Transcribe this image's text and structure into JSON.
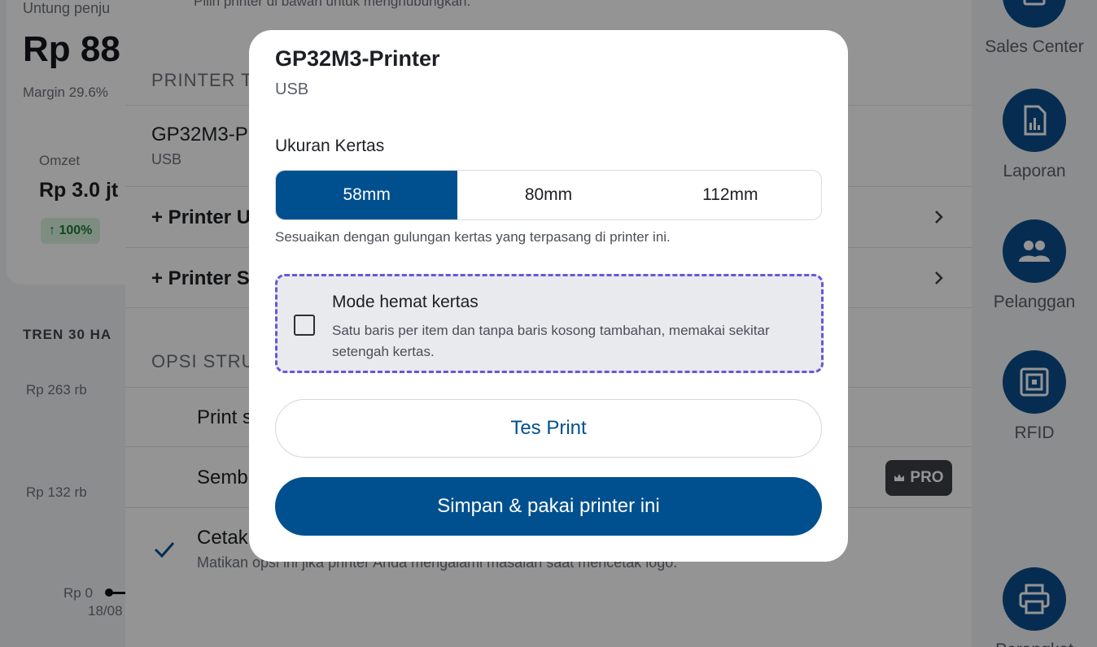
{
  "dashboard": {
    "untung_label": "Untung penju",
    "amount": "Rp 88",
    "margin": "Margin 29.6%",
    "omzet_label": "Omzet",
    "omzet_value": "Rp 3.0 jt",
    "growth": "↑ 100%",
    "trend_title": "TREN 30 HA",
    "y_top": "Rp 263 rb",
    "y_mid": "Rp 132 rb",
    "y_zero": "Rp 0",
    "x_first": "18/08"
  },
  "panel": {
    "hint": "Pilih printer di bawah untuk menghubungkan.",
    "section_printer": "PRINTER T",
    "printer_name": "GP32M3-P",
    "printer_conn": "USB",
    "add_usb": "+ Printer U",
    "add_second": "+ Printer S",
    "section_options": "OPSI STRU",
    "opt_print": "Print s",
    "opt_hide": "Semb",
    "opt_logo": "Cetak",
    "opt_logo_sub": "Matikan opsi ini jika printer Anda mengalami masalah saat mencetak logo.",
    "pro_badge": "PRO"
  },
  "sidebar": {
    "items": [
      {
        "label": "Sales Center",
        "icon": "sales-icon"
      },
      {
        "label": "Laporan",
        "icon": "report-icon"
      },
      {
        "label": "Pelanggan",
        "icon": "customers-icon"
      },
      {
        "label": "RFID",
        "icon": "rfid-icon"
      },
      {
        "label": "Perangkat",
        "icon": "printer-icon"
      }
    ]
  },
  "modal": {
    "title": "GP32M3-Printer",
    "connection": "USB",
    "paper_label": "Ukuran Kertas",
    "paper_options": [
      "58mm",
      "80mm",
      "112mm"
    ],
    "paper_selected": "58mm",
    "paper_hint": "Sesuaikan dengan gulungan kertas yang terpasang di printer ini.",
    "saver_title": "Mode hemat kertas",
    "saver_desc": "Satu baris per item dan tanpa baris kosong tambahan, memakai sekitar setengah kertas.",
    "saver_checked": false,
    "test_button": "Tes Print",
    "save_button": "Simpan & pakai printer ini"
  },
  "colors": {
    "primary": "#00508f",
    "focus_outline": "#6a55d8"
  }
}
